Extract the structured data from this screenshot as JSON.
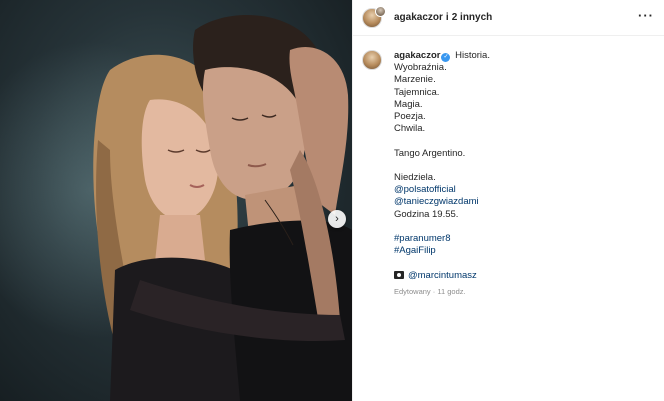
{
  "header": {
    "username": "agakaczor",
    "separator": "i",
    "others": "2 innych",
    "more_icon": "more-horizontal-icon"
  },
  "photo": {
    "next_icon": "chevron-right-icon",
    "next_glyph": "›"
  },
  "caption": {
    "author": "agakaczor",
    "verified_icon": "verified-badge-icon",
    "verified_glyph": "✓",
    "lines_1": [
      "Historia.",
      "Wyobraźnia.",
      "Marzenie.",
      "Tajemnica.",
      "Magia.",
      "Poezja.",
      "Chwila."
    ],
    "tango": "Tango Argentino.",
    "sunday": "Niedziela.",
    "mention_1": "@polsatofficial",
    "mention_2": "@tanieczgwiazdami",
    "time": "Godzina 19.55.",
    "hashtag_1": "#paranumer8",
    "hashtag_2": "#AgaiFilip",
    "camera_icon": "camera-icon",
    "photographer": "@marcintumasz",
    "edited": "Edytowany · 11 godz."
  },
  "colors": {
    "link": "#00376b",
    "verified": "#3897f0",
    "meta": "#8e8e8e"
  }
}
